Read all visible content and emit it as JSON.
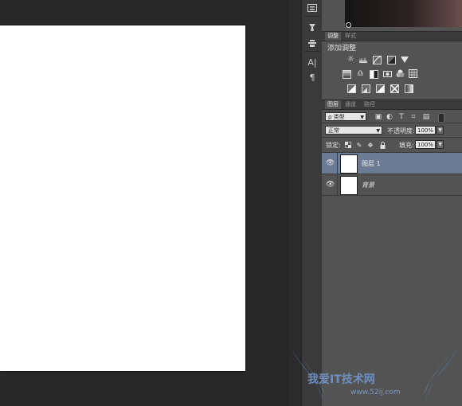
{
  "document": {
    "canvas_color": "#ffffff"
  },
  "toolstrip": {
    "items": [
      "info-panel-icon",
      "brush-settings-icon",
      "clone-source-icon",
      "character-icon",
      "paragraph-icon"
    ],
    "glyphs": {
      "character": "A|",
      "paragraph": "¶"
    }
  },
  "adjustments_panel": {
    "tabs": [
      {
        "label": "调整",
        "active": true
      },
      {
        "label": "样式",
        "active": false
      }
    ],
    "title": "添加调整",
    "rows": [
      [
        "brightness-contrast-icon",
        "levels-icon",
        "curves-icon",
        "exposure-icon",
        "vibrance-icon"
      ],
      [
        "hue-saturation-icon",
        "color-balance-icon",
        "black-white-icon",
        "photo-filter-icon",
        "channel-mixer-icon",
        "color-lookup-icon"
      ],
      [
        "invert-icon",
        "posterize-icon",
        "threshold-icon",
        "selective-color-icon",
        "gradient-map-icon"
      ]
    ]
  },
  "layers_panel": {
    "tabs": [
      {
        "label": "图层",
        "active": true
      },
      {
        "label": "通道",
        "active": false
      },
      {
        "label": "路径",
        "active": false
      }
    ],
    "filter_select": "类型",
    "filter_prefix": "ρ",
    "blend_mode": "正常",
    "opacity_label": "不透明度:",
    "opacity_value": "100%",
    "lock_label": "锁定:",
    "fill_label": "填充:",
    "fill_value": "100%",
    "layers": [
      {
        "name": "图层 1",
        "selected": true,
        "italic": false
      },
      {
        "name": "背景",
        "selected": false,
        "italic": true
      }
    ]
  },
  "watermark": {
    "text": "我爱IT技术网",
    "url": "www.52ij.com",
    "color": "#6f8fc0"
  }
}
